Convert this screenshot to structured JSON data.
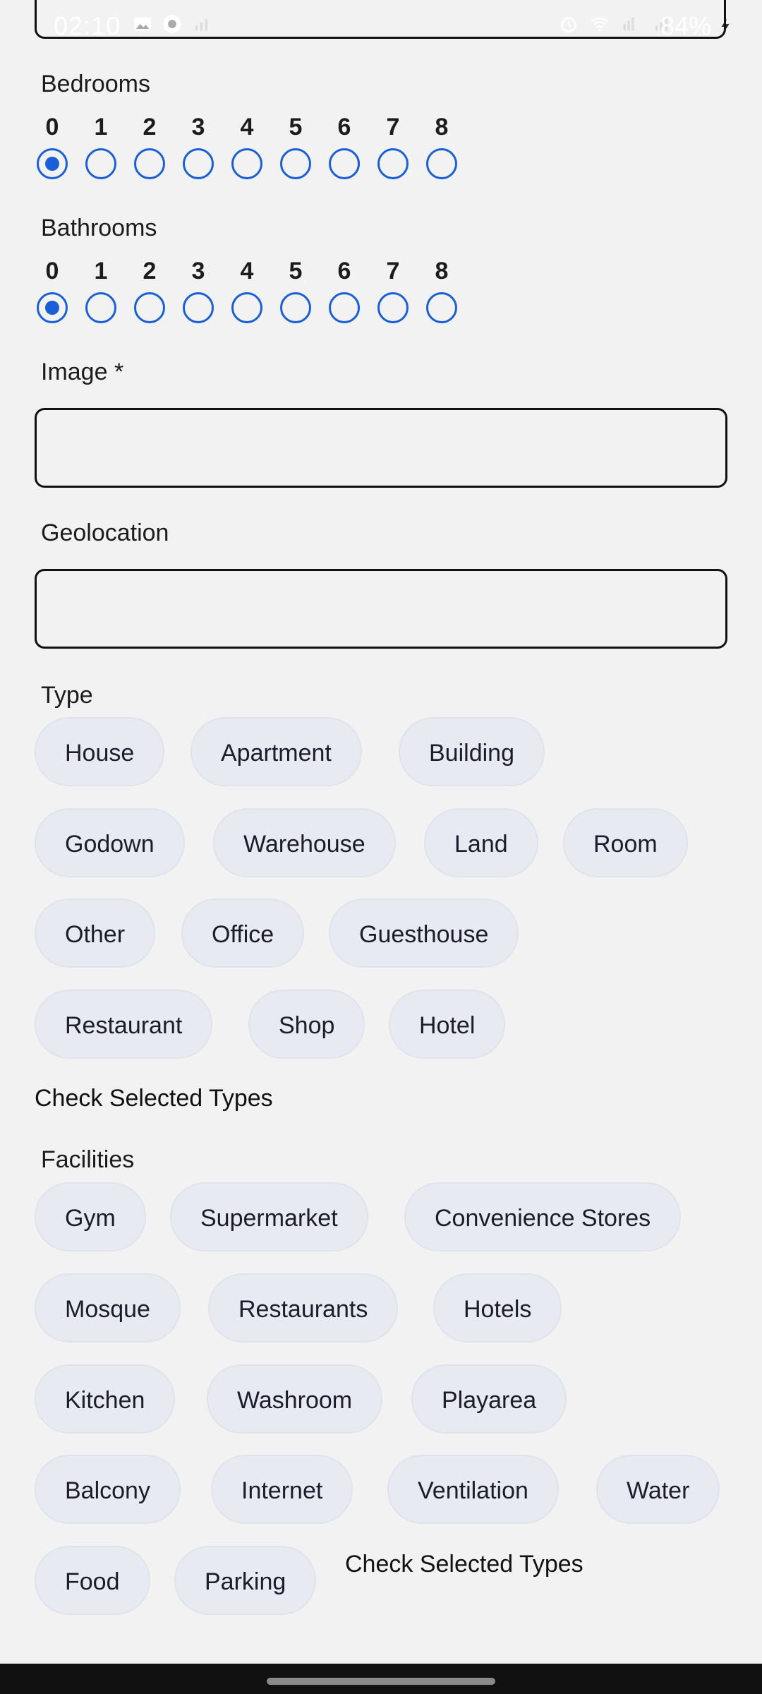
{
  "status_bar": {
    "time": "02:10",
    "battery": "84%",
    "icons": [
      "image-icon",
      "app-icon",
      "signal-small-icon",
      "alarm-icon",
      "wifi-icon",
      "volte-icon",
      "signal-icon",
      "charging-icon"
    ]
  },
  "form": {
    "bedrooms": {
      "label": "Bedrooms",
      "options": [
        "0",
        "1",
        "2",
        "3",
        "4",
        "5",
        "6",
        "7",
        "8"
      ],
      "selected": "0"
    },
    "bathrooms": {
      "label": "Bathrooms",
      "options": [
        "0",
        "1",
        "2",
        "3",
        "4",
        "5",
        "6",
        "7",
        "8"
      ],
      "selected": "0"
    },
    "image": {
      "label": "Image *",
      "value": ""
    },
    "geolocation": {
      "label": "Geolocation",
      "value": ""
    },
    "type": {
      "label": "Type",
      "chips": [
        "House",
        "Apartment",
        "Building",
        "Godown",
        "Warehouse",
        "Land",
        "Room",
        "Other",
        "Office",
        "Guesthouse",
        "Restaurant",
        "Shop",
        "Hotel"
      ],
      "check_text": "Check Selected Types"
    },
    "facilities": {
      "label": "Facilities",
      "chips": [
        "Gym",
        "Supermarket",
        "Convenience Stores",
        "Mosque",
        "Restaurants",
        "Hotels",
        "Kitchen",
        "Washroom",
        "Playarea",
        "Balcony",
        "Internet",
        "Ventilation",
        "Water",
        "Food",
        "Parking"
      ],
      "check_text": "Check Selected Types"
    }
  },
  "colors": {
    "accent": "#1a5fd6",
    "chip_bg": "#e8eaf1",
    "page_bg": "#f2f2f2"
  }
}
